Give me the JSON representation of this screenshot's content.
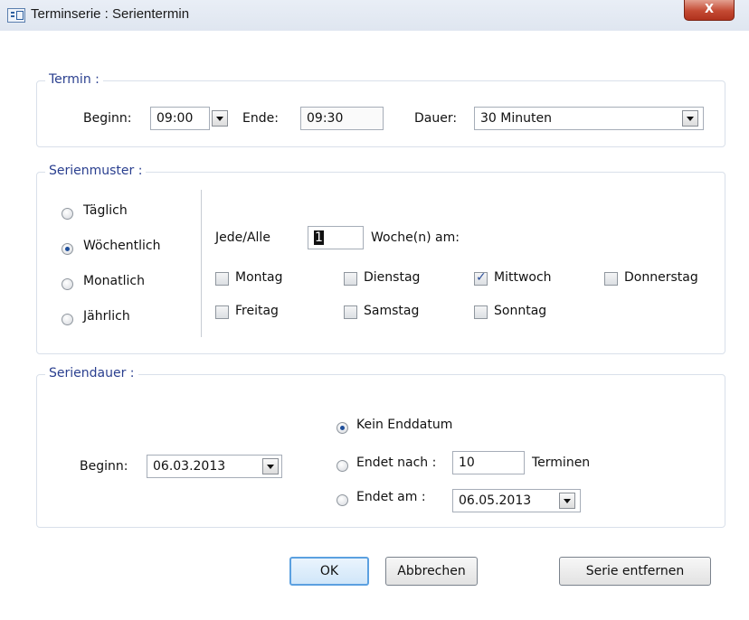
{
  "window": {
    "title": "Terminserie : Serientermin",
    "close_label": "X"
  },
  "termin": {
    "legend": "Termin :",
    "beginn_label": "Beginn:",
    "beginn_value": "09:00",
    "ende_label": "Ende:",
    "ende_value": "09:30",
    "dauer_label": "Dauer:",
    "dauer_value": "30 Minuten"
  },
  "serienmuster": {
    "legend": "Serienmuster :",
    "options": [
      {
        "label": "Täglich",
        "selected": false
      },
      {
        "label": "Wöchentlich",
        "selected": true
      },
      {
        "label": "Monatlich",
        "selected": false
      },
      {
        "label": "Jährlich",
        "selected": false
      }
    ],
    "jede_label": "Jede/Alle",
    "interval_value": "1",
    "woche_label": "Woche(n) am:",
    "days": [
      {
        "label": "Montag",
        "checked": false
      },
      {
        "label": "Dienstag",
        "checked": false
      },
      {
        "label": "Mittwoch",
        "checked": true
      },
      {
        "label": "Donnerstag",
        "checked": false
      },
      {
        "label": "Freitag",
        "checked": false
      },
      {
        "label": "Samstag",
        "checked": false
      },
      {
        "label": "Sonntag",
        "checked": false
      }
    ]
  },
  "seriendauer": {
    "legend": "Seriendauer :",
    "beginn_label": "Beginn:",
    "beginn_value": "06.03.2013",
    "kein_enddatum": "Kein Enddatum",
    "endet_nach": "Endet nach :",
    "endet_nach_value": "10",
    "terminen": "Terminen",
    "endet_am": "Endet am :",
    "endet_am_value": "06.05.2013",
    "end_mode": "kein_enddatum"
  },
  "buttons": {
    "ok": "OK",
    "cancel": "Abbrechen",
    "remove": "Serie entfernen"
  }
}
